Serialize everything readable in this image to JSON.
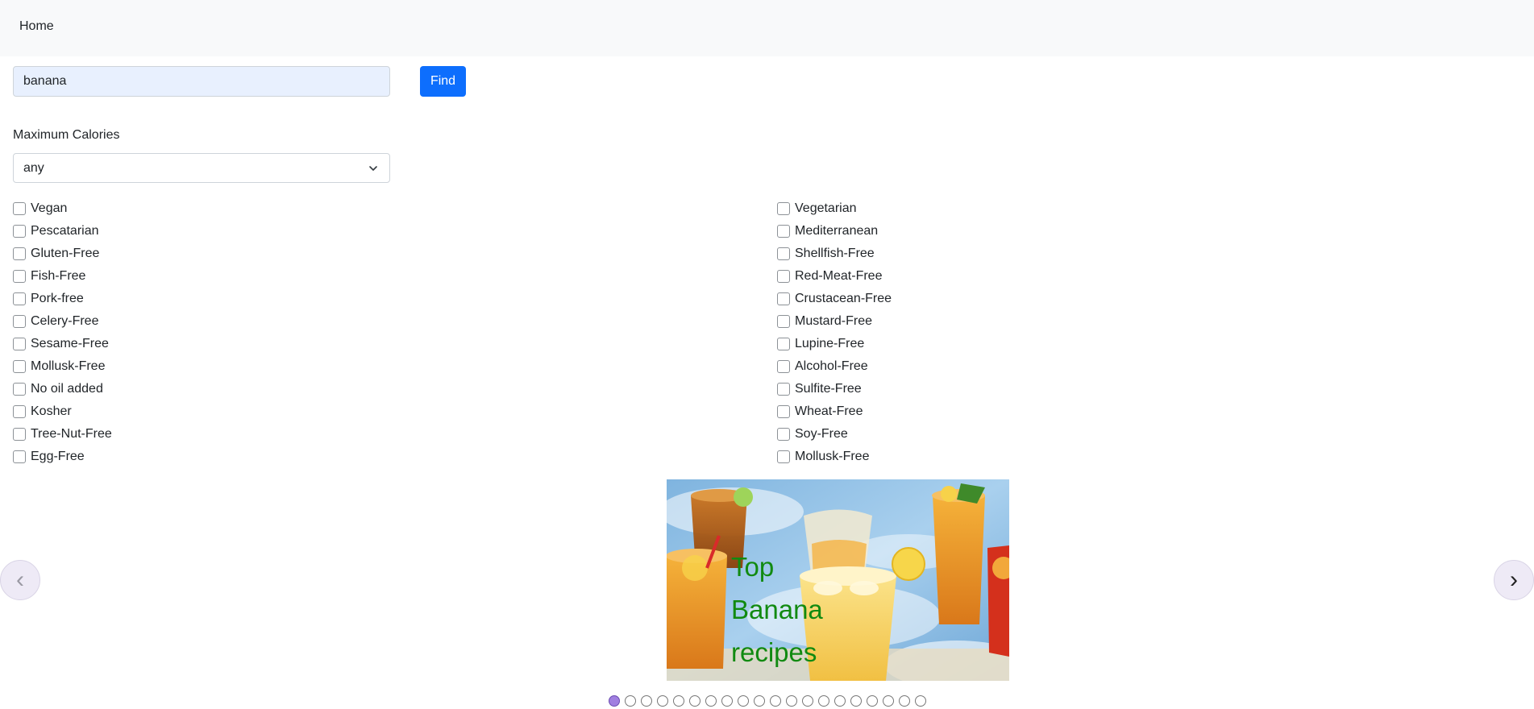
{
  "nav": {
    "home_label": "Home"
  },
  "search": {
    "value": "banana",
    "find_label": "Find"
  },
  "calories": {
    "label": "Maximum Calories",
    "selected": "any"
  },
  "health_left": [
    "Vegan",
    "Pescatarian",
    "Gluten-Free",
    "Fish-Free",
    "Pork-free",
    "Celery-Free",
    "Sesame-Free",
    "Mollusk-Free",
    "No oil added",
    "Kosher",
    "Tree-Nut-Free",
    "Egg-Free"
  ],
  "health_right": [
    "Vegetarian",
    "Mediterranean",
    "Shellfish-Free",
    "Red-Meat-Free",
    "Crustacean-Free",
    "Mustard-Free",
    "Lupine-Free",
    "Alcohol-Free",
    "Sulfite-Free",
    "Wheat-Free",
    "Soy-Free",
    "Mollusk-Free"
  ],
  "carousel": {
    "slide_title": "Top Banana recipes",
    "title_color": "#118a11",
    "prev_icon": "‹",
    "next_icon": "›",
    "dot_count": 20,
    "active_dot": 0
  }
}
